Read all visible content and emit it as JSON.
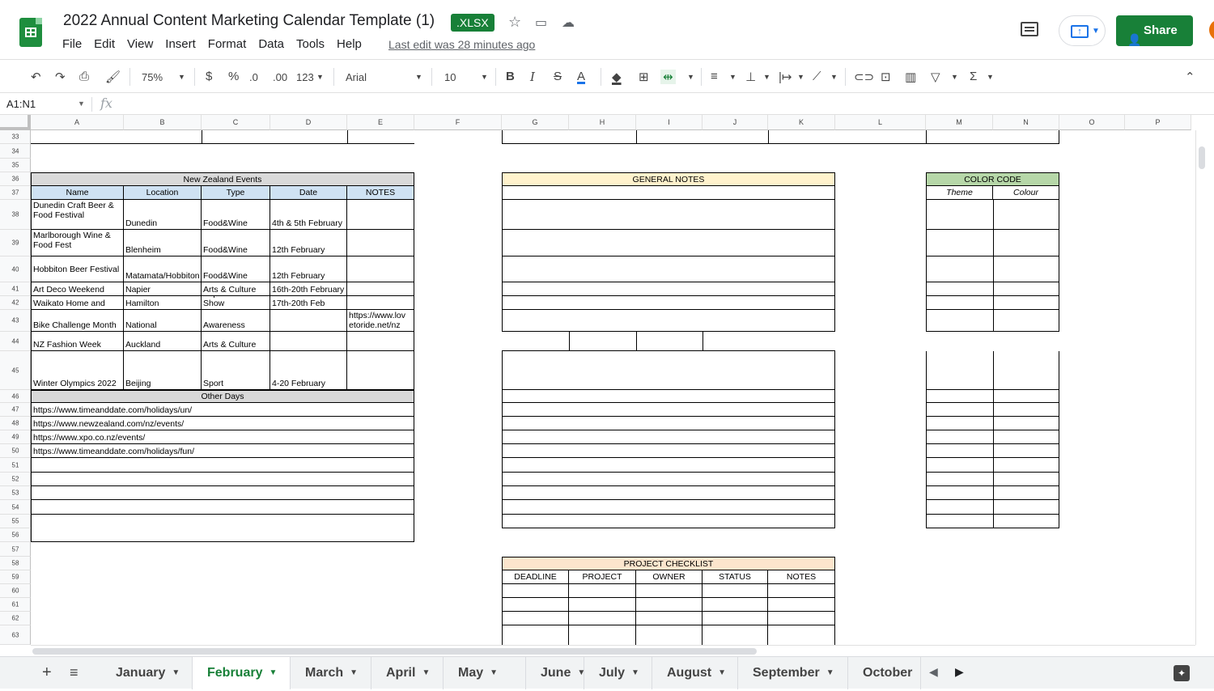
{
  "doc": {
    "title": "2022 Annual Content Marketing Calendar Template (1)",
    "badge": ".XLSX",
    "last_edit": "Last edit was 28 minutes ago",
    "share": "Share",
    "icons": [
      "star-icon",
      "move-to-folder-icon",
      "cloud-status-icon"
    ]
  },
  "menu": [
    "File",
    "Edit",
    "View",
    "Insert",
    "Format",
    "Data",
    "Tools",
    "Help"
  ],
  "toolbar": {
    "zoom": "75%",
    "currency": "$",
    "percent": "%",
    "dec_less": ".0",
    "dec_more": ".00",
    "format": "123",
    "font": "Arial",
    "size": "10"
  },
  "formula": {
    "name_box": "A1:N1",
    "fx": "fx"
  },
  "columns": [
    "A",
    "B",
    "C",
    "D",
    "E",
    "F",
    "G",
    "H",
    "I",
    "J",
    "K",
    "L",
    "M",
    "N",
    "O",
    "P"
  ],
  "rows": [
    "33",
    "34",
    "35",
    "36",
    "37",
    "38",
    "39",
    "40",
    "41",
    "42",
    "43",
    "44",
    "45",
    "46",
    "47",
    "48",
    "49",
    "50",
    "51",
    "52",
    "53",
    "54",
    "55",
    "56",
    "57",
    "58",
    "59",
    "60",
    "61",
    "62",
    "63"
  ],
  "nz_events": {
    "title": "New Zealand Events",
    "headers": [
      "Name",
      "Location",
      "Type",
      "Date",
      "NOTES"
    ],
    "rows": [
      [
        "Dunedin Craft Beer & Food Festival",
        "Dunedin",
        "Food&Wine",
        "4th & 5th February",
        ""
      ],
      [
        "Marlborough Wine & Food Fest",
        "Blenheim",
        "Food&Wine",
        "12th February",
        ""
      ],
      [
        "Hobbiton Beer Festival",
        "Matamata/Hobbiton",
        "Food&Wine",
        "12th February",
        ""
      ],
      [
        "Art Deco Weekend",
        "Napier",
        "Arts & Culture",
        "16th-20th February",
        ""
      ],
      [
        "Waikato Home and",
        "Hamilton",
        "Expo/Trade Show",
        "17th-20th Feb",
        ""
      ],
      [
        "Bike Challenge Month",
        "National",
        "Awareness",
        "",
        "https://www.lov etoride.net/nz"
      ],
      [
        "NZ Fashion Week",
        "Auckland",
        "Arts & Culture",
        "",
        ""
      ],
      [
        "Winter Olympics 2022",
        "Beijing",
        "Sport",
        "4-20 February",
        ""
      ]
    ],
    "other_days_title": "Other Days",
    "other_days": [
      "https://www.timeanddate.com/holidays/un/",
      "https://www.newzealand.com/nz/events/",
      "https://www.xpo.co.nz/events/",
      "https://www.timeanddate.com/holidays/fun/"
    ]
  },
  "general_notes": {
    "title": "GENERAL NOTES"
  },
  "color_code": {
    "title": "COLOR CODE",
    "headers": [
      "Theme",
      "Colour"
    ]
  },
  "project_checklist": {
    "title": "PROJECT CHECKLIST",
    "headers": [
      "DEADLINE",
      "PROJECT",
      "OWNER",
      "STATUS",
      "NOTES"
    ]
  },
  "tabs": [
    "January",
    "February",
    "March",
    "April",
    "May",
    "June",
    "July",
    "August",
    "September",
    "October"
  ],
  "active_tab": "February",
  "colors": {
    "green": "#188038",
    "notes_yellow": "#fff2cc",
    "code_green": "#b6d7a8",
    "checklist_orange": "#fce5cd",
    "table_blue": "#cfe2f3",
    "gray_band": "#d9d9d9"
  }
}
